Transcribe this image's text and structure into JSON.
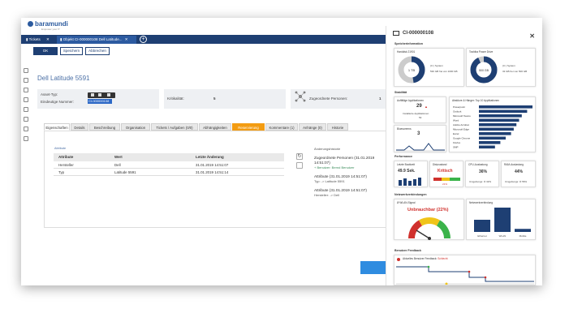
{
  "app": {
    "brand": "baramundi",
    "brand_sub": "Empower your IT"
  },
  "tabs": [
    {
      "label": "Tickets",
      "close": "✕"
    },
    {
      "label": "Objekt CI-000000108 Dell Latitude...",
      "close": "✕"
    }
  ],
  "toolbar": {
    "ok": "OK",
    "save": "Speichern",
    "cancel": "Abbrechen"
  },
  "asset": {
    "title": "Dell Latitude 5591",
    "type_label": "Asset-Typ:",
    "number_label": "Eindeutige Nummer:",
    "number_value": "CI-000000108",
    "criticality_label": "Kritikalität:",
    "criticality_value": "5",
    "persons_label": "Zugeordnete Personen:",
    "persons_value": "1"
  },
  "detail_tabs": [
    "Eigenschaften",
    "Details",
    "Beschreibung",
    "Organisation",
    "Tickets / Aufgaben (0/0)",
    "Abhängigkeiten",
    "Reservierung",
    "Kommentare (1)",
    "Anhänge (0)",
    "Historie"
  ],
  "attributes": {
    "section_label": "Attribute",
    "history_label": "Änderungshistorie",
    "columns": [
      "Attribute",
      "Wert",
      "Letzte Änderung"
    ],
    "rows": [
      [
        "Hersteller",
        "Dell",
        "31.01.2019 14:51:07"
      ],
      [
        "Typ",
        "Latitude 5591",
        "31.01.2019 14:51:14"
      ]
    ]
  },
  "history": [
    {
      "title": "Zugeordnete Personen (31.01.2019 14:51:07)",
      "sub": "+ Benutzer: Bernd Benutzer",
      "green": true
    },
    {
      "title": "Attribute (31.01.2019 14:51:07)",
      "sub": "Typ: -> Latitude 5591",
      "green": false
    },
    {
      "title": "Attribute (31.01.2019 14:51:07)",
      "sub": "Hersteller: -> Dell",
      "green": false
    }
  ],
  "panel": {
    "title": "CI-000000108",
    "storage_label": "Speicherinformation",
    "disk1": {
      "name": "Harddisk 21901",
      "center": "1 TB",
      "drive": "(C:) System",
      "free": "530 GB frei von 1000 GB"
    },
    "disk2": {
      "name": "Toshiba Power Drive",
      "center": "500 GB",
      "drive": "(C:) System",
      "free": "32 GB frei von 500 GB"
    },
    "stability_label": "Stabilität",
    "apps": {
      "title": "Auffällige Applikationen",
      "value": "29",
      "sub1": "Installierte Applikationen",
      "sub2": "53"
    },
    "bluescreens": {
      "title": "Bluescreens",
      "value": "3"
    },
    "crashes": {
      "title": "Abstürze & Hänger: Top 10 Applikationen",
      "items": [
        "Powerpoint",
        "Outlook",
        "Microsoft Teams",
        "Word",
        "Adobe Acrobat",
        "Microsoft Edge",
        "Excel",
        "Google Chrome",
        "Firefox",
        "SMP"
      ],
      "values": [
        10,
        9,
        8,
        7.5,
        7,
        6.5,
        6,
        5,
        4,
        3
      ]
    },
    "performance_label": "Performance",
    "boot": {
      "title": "Letzte Boottzeit",
      "value": "49.9 Sek."
    },
    "disk": {
      "title": "Diskzustand",
      "value": "Kritisch",
      "pct": "21%"
    },
    "cpu": {
      "title": "CPU-Auslastung",
      "value": "36%",
      "sub": "Umgebungs: ⦾ 32%"
    },
    "ram": {
      "title": "RAM-Auslastung",
      "value": "44%",
      "sub": "Umgebungs: ⦾ 56%"
    },
    "network_label": "Netzwerkverbindungen",
    "wlan": {
      "title": "Ø WLAN-Signal",
      "value": "Unbrauchbar (22%)",
      "level": 0.22
    },
    "conn": {
      "title": "Netzwerkverbindung",
      "bars": [
        "Ethernet",
        "WLAN",
        "Mobile"
      ],
      "values": [
        4,
        8,
        1
      ]
    },
    "feedback_label": "Benutzer Feedback",
    "feedback": {
      "title": "Aktuelles Benutzer Feedback:",
      "value": "Schlecht"
    }
  },
  "colors": {
    "navy": "#1e3f73",
    "blue": "#2c5aa0",
    "orange": "#f39c12",
    "red": "#d0312d",
    "green": "#3bb34a"
  }
}
